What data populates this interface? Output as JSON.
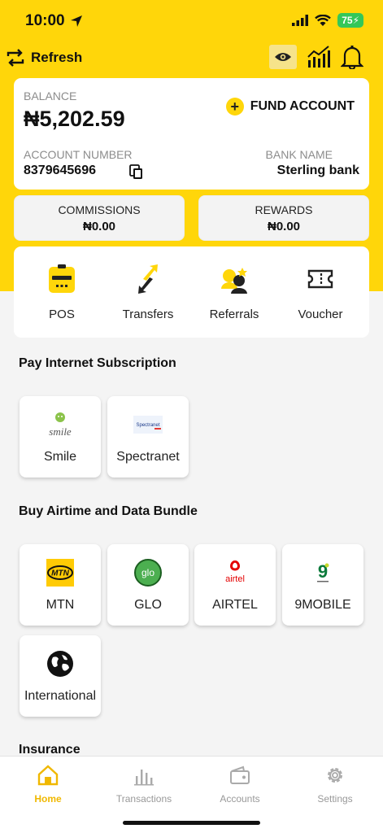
{
  "status": {
    "time": "10:00",
    "battery": "75"
  },
  "header": {
    "refresh_label": "Refresh"
  },
  "balance": {
    "label": "BALANCE",
    "amount": "₦5,202.59",
    "fund_label": "FUND ACCOUNT",
    "account_number_label": "ACCOUNT NUMBER",
    "account_number": "8379645696",
    "bank_name_label": "BANK NAME",
    "bank_name": "Sterling bank"
  },
  "commissions": {
    "label": "COMMISSIONS",
    "value": "₦0.00"
  },
  "rewards": {
    "label": "REWARDS",
    "value": "₦0.00"
  },
  "services": [
    {
      "label": "POS"
    },
    {
      "label": "Transfers"
    },
    {
      "label": "Referrals"
    },
    {
      "label": "Voucher"
    }
  ],
  "internet": {
    "title": "Pay Internet Subscription",
    "items": [
      {
        "label": "Smile",
        "logo": "smile"
      },
      {
        "label": "Spectranet",
        "logo": "Spectranet"
      }
    ]
  },
  "airtime": {
    "title": "Buy Airtime and Data Bundle",
    "items": [
      {
        "label": "MTN",
        "logo": "MTN"
      },
      {
        "label": "GLO",
        "logo": "glo"
      },
      {
        "label": "AIRTEL",
        "logo": "airtel"
      },
      {
        "label": "9MOBILE",
        "logo": "9"
      },
      {
        "label": "International"
      }
    ]
  },
  "insurance": {
    "title": "Insurance"
  },
  "tabs": [
    {
      "label": "Home"
    },
    {
      "label": "Transactions"
    },
    {
      "label": "Accounts"
    },
    {
      "label": "Settings"
    }
  ],
  "colors": {
    "brand": "#ffd60a",
    "active_tab": "#f0b800"
  }
}
